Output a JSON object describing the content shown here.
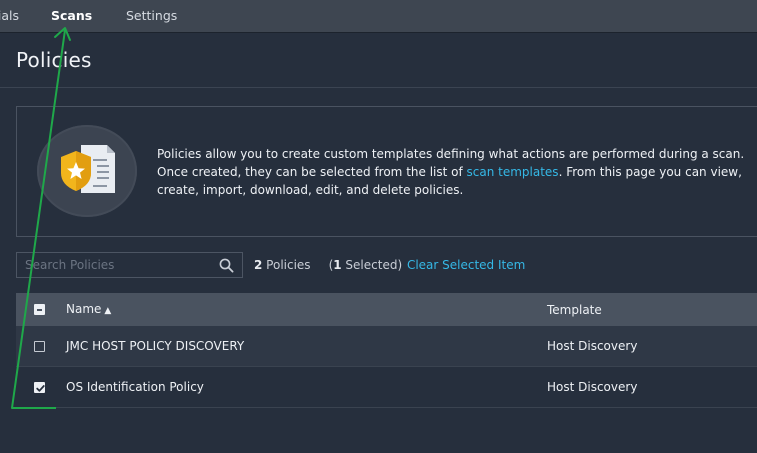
{
  "nav": {
    "items": [
      {
        "id": "credentials",
        "label": "tials"
      },
      {
        "id": "scans",
        "label": "Scans"
      },
      {
        "id": "settings",
        "label": "Settings"
      }
    ],
    "active": "scans"
  },
  "page": {
    "title": "Policies"
  },
  "info": {
    "text_part1": "Policies allow you to create custom templates defining what actions are performed during a scan. Once created, they can be selected from the list of ",
    "link_text": "scan templates",
    "text_part2": ". From this page you can view, create, import, download, edit, and delete policies.",
    "icon": "policy-document-star-icon"
  },
  "search": {
    "placeholder": "Search Policies",
    "value": "",
    "icon": "search-icon"
  },
  "counts": {
    "total_number": "2",
    "total_label": " Policies",
    "selected_open": "(",
    "selected_number": "1",
    "selected_label": " Selected)",
    "clear_label": "Clear Selected Item"
  },
  "table": {
    "columns": {
      "name": "Name",
      "sort_indicator": "▲",
      "template": "Template"
    },
    "rows": [
      {
        "name": "JMC HOST POLICY DISCOVERY",
        "template": "Host Discovery",
        "checked": false
      },
      {
        "name": "OS Identification Policy",
        "template": "Host Discovery",
        "checked": true
      }
    ]
  },
  "colors": {
    "background": "#262f3d",
    "nav_background": "#3e4651",
    "link": "#35b8e6",
    "table_header": "#4a5360",
    "annotation": "#1fa84a",
    "shield": "#f2b51c"
  }
}
